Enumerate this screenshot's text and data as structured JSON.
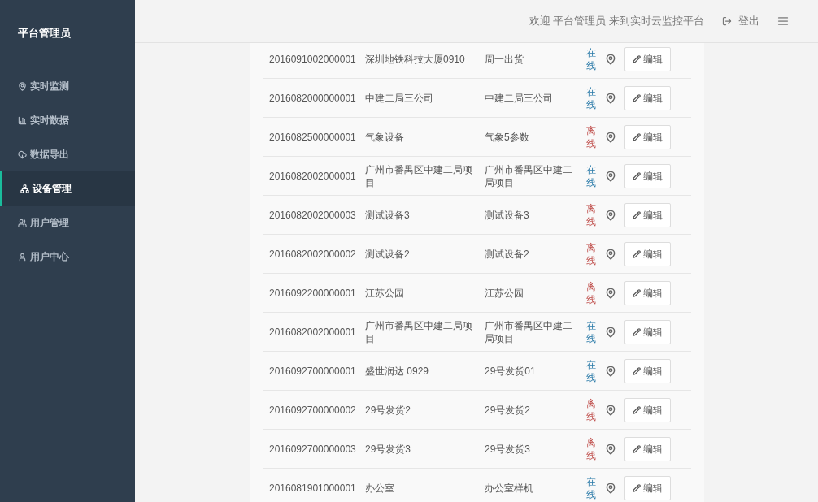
{
  "sidebar": {
    "title": "平台管理员",
    "items": [
      {
        "label": "实时监测",
        "kind": "pin",
        "selected": false
      },
      {
        "label": "实时数据",
        "kind": "chart",
        "selected": false
      },
      {
        "label": "数据导出",
        "kind": "cloud",
        "selected": false
      },
      {
        "label": "设备管理",
        "kind": "sitemap",
        "selected": true
      },
      {
        "label": "用户管理",
        "kind": "users",
        "selected": false
      },
      {
        "label": "用户中心",
        "kind": "user",
        "selected": false
      }
    ]
  },
  "header": {
    "welcome": "欢迎 平台管理员 来到实时云监控平台",
    "logout": "登出"
  },
  "table": {
    "rows": [
      {
        "id": "2016091002000001",
        "name": "深圳地铁科技大厦0910",
        "remark": "周一出货",
        "status": "在线",
        "online": true,
        "action": "编辑"
      },
      {
        "id": "2016082000000001",
        "name": "中建二局三公司",
        "remark": "中建二局三公司",
        "status": "在线",
        "online": true,
        "action": "编辑"
      },
      {
        "id": "2016082500000001",
        "name": "气象设备",
        "remark": "气象5参数",
        "status": "离线",
        "online": false,
        "action": "编辑"
      },
      {
        "id": "2016082002000001",
        "name": "广州市番禺区中建二局项目",
        "remark": "广州市番禺区中建二局项目",
        "status": "在线",
        "online": true,
        "action": "编辑"
      },
      {
        "id": "2016082002000003",
        "name": "测试设备3",
        "remark": "测试设备3",
        "status": "离线",
        "online": false,
        "action": "编辑"
      },
      {
        "id": "2016082002000002",
        "name": "测试设备2",
        "remark": "测试设备2",
        "status": "离线",
        "online": false,
        "action": "编辑"
      },
      {
        "id": "2016092200000001",
        "name": "江苏公园",
        "remark": "江苏公园",
        "status": "离线",
        "online": false,
        "action": "编辑"
      },
      {
        "id": "2016082002000001",
        "name": "广州市番禺区中建二局项目",
        "remark": "广州市番禺区中建二局项目",
        "status": "在线",
        "online": true,
        "action": "编辑"
      },
      {
        "id": "2016092700000001",
        "name": "盛世润达 0929",
        "remark": "29号发货01",
        "status": "在线",
        "online": true,
        "action": "编辑"
      },
      {
        "id": "2016092700000002",
        "name": "29号发货2",
        "remark": "29号发货2",
        "status": "离线",
        "online": false,
        "action": "编辑"
      },
      {
        "id": "2016092700000003",
        "name": "29号发货3",
        "remark": "29号发货3",
        "status": "离线",
        "online": false,
        "action": "编辑"
      },
      {
        "id": "2016081901000001",
        "name": "办公室",
        "remark": "办公室样机",
        "status": "在线",
        "online": true,
        "action": "编辑"
      }
    ]
  }
}
